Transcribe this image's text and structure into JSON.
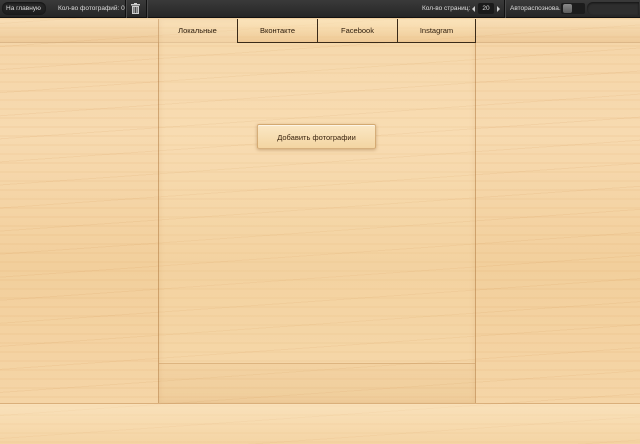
{
  "toolbar": {
    "home_label": "На главную",
    "photo_count_label": "Кол-во фотографий: 0",
    "pages_label": "Кол-во страниц:",
    "pages_value": "20",
    "autoslide_label": "Автораспознова."
  },
  "tabs": [
    {
      "label": "Локальные",
      "active": true
    },
    {
      "label": "Вконтакте",
      "active": false
    },
    {
      "label": "Facebook",
      "active": false
    },
    {
      "label": "Instagram",
      "active": false
    }
  ],
  "main": {
    "add_photos_label": "Добавить фотографии"
  },
  "icons": {
    "trash": "trash-icon",
    "prev": "arrow-left-icon",
    "next": "arrow-right-icon"
  }
}
